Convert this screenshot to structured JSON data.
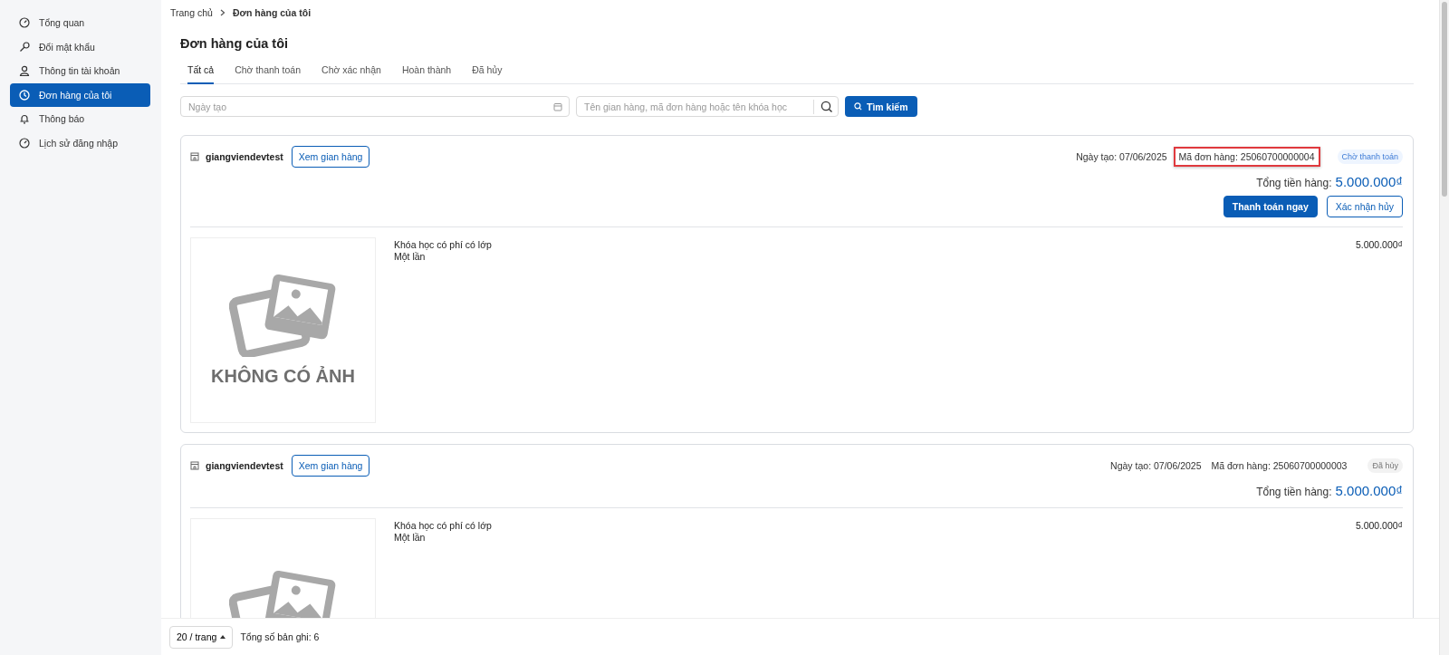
{
  "sidebar": {
    "items": [
      {
        "label": "Tổng quan",
        "kind": "overview",
        "selected": false
      },
      {
        "label": "Đổi mật khẩu",
        "kind": "password",
        "selected": false
      },
      {
        "label": "Thông tin tài khoản",
        "kind": "account",
        "selected": false
      },
      {
        "label": "Đơn hàng của tôi",
        "kind": "orders",
        "selected": true
      },
      {
        "label": "Thông báo",
        "kind": "notifications",
        "selected": false
      },
      {
        "label": "Lịch sử đăng nhập",
        "kind": "history",
        "selected": false
      }
    ]
  },
  "breadcrumb": [
    "Trang chủ",
    "Đơn hàng của tôi"
  ],
  "page_title": "Đơn hàng của tôi",
  "tabs": [
    {
      "label": "Tất cả",
      "selected": true
    },
    {
      "label": "Chờ thanh toán",
      "selected": false
    },
    {
      "label": "Chờ xác nhận",
      "selected": false
    },
    {
      "label": "Hoàn thành",
      "selected": false
    },
    {
      "label": "Đã hủy",
      "selected": false
    }
  ],
  "filters": {
    "date": {
      "placeholder": "Ngày tạo"
    },
    "search": {
      "placeholder": "Tên gian hàng, mã đơn hàng hoặc tên khóa học"
    },
    "search_button": "Tìm kiếm"
  },
  "orders": [
    {
      "shop": "giangviendevtest",
      "view_shop": "Xem gian hàng",
      "created": "Ngày tạo: 07/06/2025",
      "code": "Mã đơn hàng: 25060700000004",
      "highlighted": true,
      "status": {
        "label": "Chờ thanh toán",
        "kind": "pending"
      },
      "total_label": "Tổng tiền hàng:",
      "total": "5.000.000₫",
      "actions": [
        {
          "label": "Thanh toán ngay",
          "kind": "primary"
        },
        {
          "label": "Xác nhận hủy",
          "kind": "outline"
        }
      ],
      "items": [
        {
          "image_label": "KHÔNG CÓ ẢNH",
          "name": "Khóa học có phí có lớp",
          "variant": "Một lần",
          "price": "5.000.000₫"
        }
      ]
    },
    {
      "shop": "giangviendevtest",
      "view_shop": "Xem gian hàng",
      "created": "Ngày tạo: 07/06/2025",
      "code": "Mã đơn hàng: 25060700000003",
      "highlighted": false,
      "status": {
        "label": "Đã hủy",
        "kind": "cancelled"
      },
      "total_label": "Tổng tiền hàng:",
      "total": "5.000.000₫",
      "items": [
        {
          "name": "Khóa học có phí có lớp",
          "variant": "Một lần",
          "price": "5.000.000₫"
        }
      ]
    }
  ],
  "pagination": {
    "page_size": "20 / trang",
    "total": "Tổng số bản ghi: 6"
  }
}
